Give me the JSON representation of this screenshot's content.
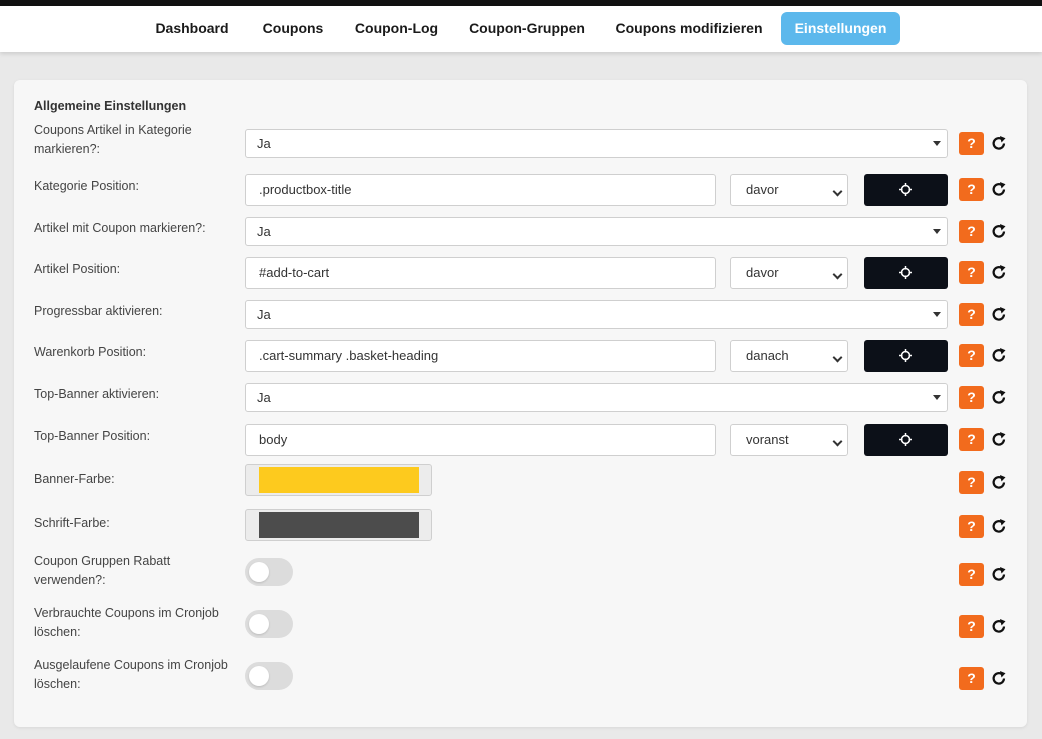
{
  "nav": {
    "items": [
      {
        "label": "Dashboard"
      },
      {
        "label": "Coupons"
      },
      {
        "label": "Coupon-Log"
      },
      {
        "label": "Coupon-Gruppen"
      },
      {
        "label": "Coupons modifizieren"
      },
      {
        "label": "Einstellungen",
        "active": true
      }
    ]
  },
  "section_title": "Allgemeine Einstellungen",
  "help_label": "?",
  "colors": {
    "accent": "#5cb8ec",
    "help_button": "#f26b1d",
    "target_button": "#0c1018",
    "banner_color": "#fdca1e",
    "font_color": "#4c4c4c"
  },
  "settings": {
    "coupons_in_category": {
      "label": "Coupons Artikel in Kategorie markieren?:",
      "value": "Ja"
    },
    "category_position": {
      "label": "Kategorie Position:",
      "value": ".productbox-title",
      "placement": "davor"
    },
    "mark_article": {
      "label": "Artikel mit Coupon markieren?:",
      "value": "Ja"
    },
    "article_position": {
      "label": "Artikel Position:",
      "value": "#add-to-cart",
      "placement": "davor"
    },
    "progressbar": {
      "label": "Progressbar aktivieren:",
      "value": "Ja"
    },
    "cart_position": {
      "label": "Warenkorb Position:",
      "value": ".cart-summary .basket-heading",
      "placement": "danach"
    },
    "top_banner": {
      "label": "Top-Banner aktivieren:",
      "value": "Ja"
    },
    "top_banner_position": {
      "label": "Top-Banner Position:",
      "value": "body",
      "placement": "voranst"
    },
    "banner_color": {
      "label": "Banner-Farbe:"
    },
    "font_color": {
      "label": "Schrift-Farbe:"
    },
    "group_discount": {
      "label": "Coupon Gruppen Rabatt verwenden?:",
      "enabled": false
    },
    "delete_used": {
      "label": "Verbrauchte Coupons im Cronjob löschen:",
      "enabled": false
    },
    "delete_expired": {
      "label": "Ausgelaufene Coupons im Cronjob löschen:",
      "enabled": false
    }
  }
}
